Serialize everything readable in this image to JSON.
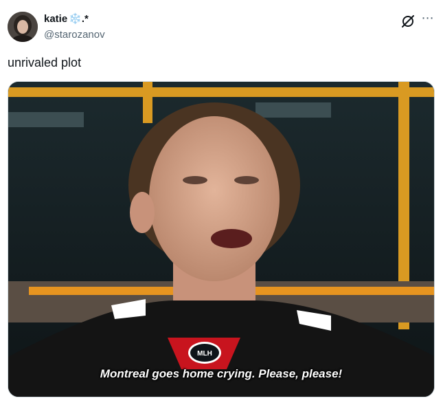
{
  "author": {
    "display_name": "katie",
    "name_badge": "❄️.*",
    "handle": "@starozanov"
  },
  "post": {
    "text": "unrivaled plot"
  },
  "media": {
    "subtitle": "Montreal goes home crying. Please, please!",
    "jersey_logo_text": "MLH"
  },
  "icons": {
    "grok": "grok-icon",
    "more": "more-icon"
  },
  "colors": {
    "text_primary": "#0f1419",
    "text_secondary": "#536471",
    "border": "#cfd9de",
    "jersey_red": "#c8141e",
    "locker_orange": "#e6a11c"
  }
}
